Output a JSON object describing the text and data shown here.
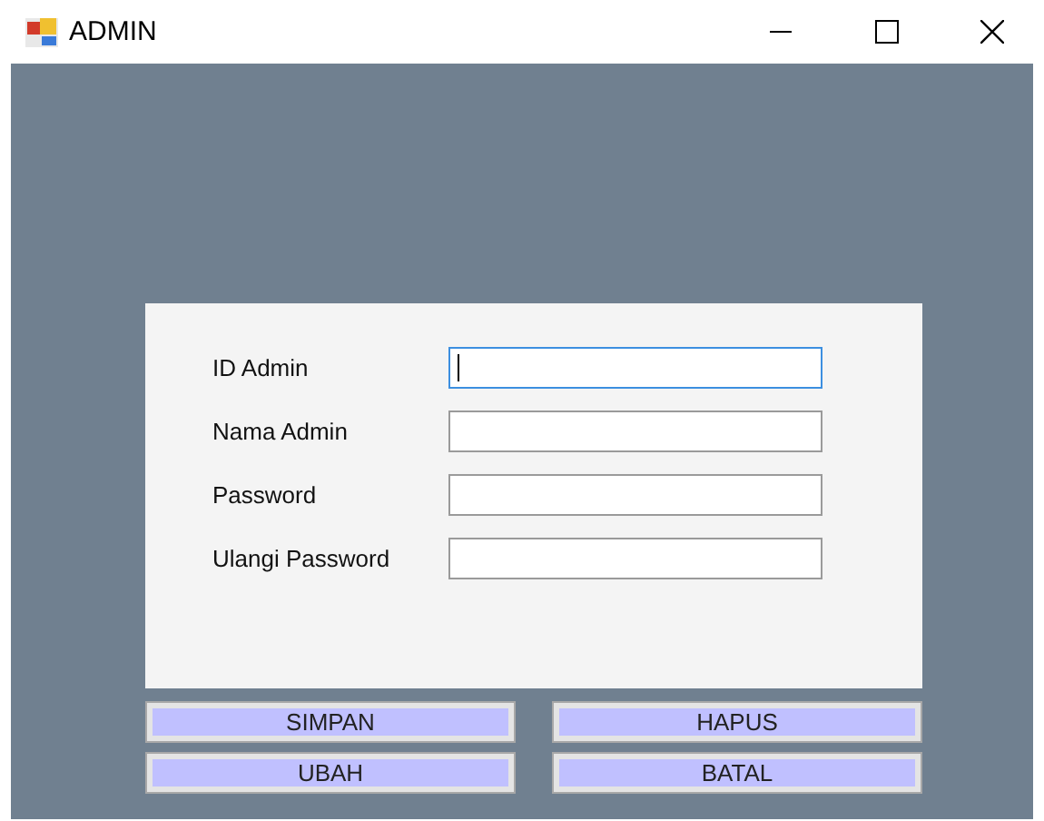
{
  "window": {
    "title": "ADMIN"
  },
  "fields": [
    {
      "label": "ID Admin",
      "focused": true
    },
    {
      "label": "Nama Admin",
      "focused": false
    },
    {
      "label": "Password",
      "focused": false
    },
    {
      "label": "Ulangi Password",
      "focused": false
    }
  ],
  "buttons": [
    "SIMPAN",
    "HAPUS",
    "UBAH",
    "BATAL"
  ]
}
